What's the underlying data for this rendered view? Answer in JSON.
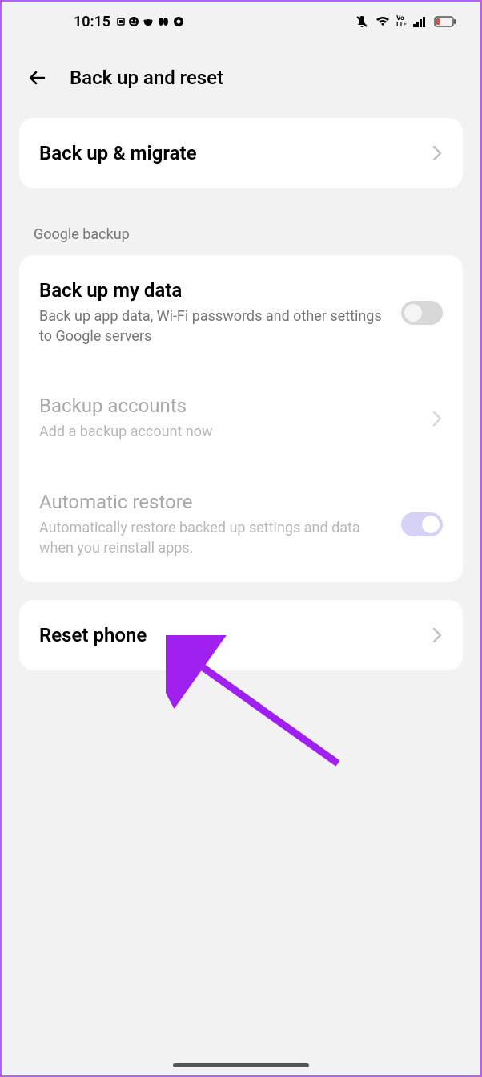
{
  "statusBar": {
    "time": "10:15"
  },
  "header": {
    "title": "Back up and reset"
  },
  "backupMigrate": {
    "title": "Back up & migrate"
  },
  "sectionLabel": "Google backup",
  "backupMyData": {
    "title": "Back up my data",
    "subtitle": "Back up app data, Wi-Fi passwords and other settings to Google servers"
  },
  "backupAccounts": {
    "title": "Backup accounts",
    "subtitle": "Add a backup account now"
  },
  "autoRestore": {
    "title": "Automatic restore",
    "subtitle": "Automatically restore backed up settings and data when you reinstall apps."
  },
  "resetPhone": {
    "title": "Reset phone"
  }
}
